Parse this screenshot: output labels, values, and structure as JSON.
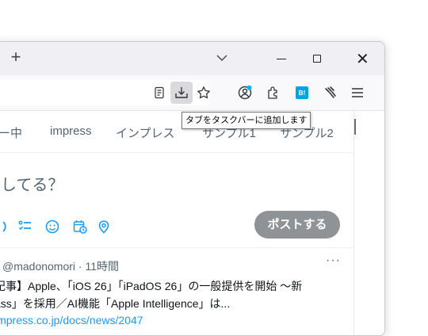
{
  "titlebar": {
    "new_tab_glyph": "+",
    "tab_list_icon": "chevron-down-icon",
    "window_controls": [
      "minimize",
      "maximize",
      "close"
    ],
    "close_glyph": "✕"
  },
  "toolbar": {
    "buttons": [
      "reader-view-icon",
      "download-to-taskbar-icon",
      "bookmark-star-icon",
      "account-icon",
      "extensions-icon",
      "hatena-bookmark-icon",
      "extension-icon",
      "menu-icon"
    ],
    "hatena_label": "B!",
    "tooltip": "タブをタスクバーに追加します"
  },
  "nav": {
    "items": [
      "ー中",
      "impress",
      "インプレス",
      "サンプル1",
      "サンプル2"
    ]
  },
  "compose": {
    "placeholder": "してる？",
    "post_button": "ポストする",
    "icons": [
      "gif-icon",
      "poll-icon",
      "emoji-icon",
      "schedule-icon",
      "location-icon"
    ]
  },
  "tweet": {
    "handle": "@madonomori",
    "separator": "·",
    "time": "11時間",
    "more": "···",
    "line1": "記事】Apple、「iOS 26」「iPadOS 26」の一般提供を開始 ～新",
    "line2": "ass」を採用／AI機能「Apple Intelligence」は...",
    "link": "impress.co.jp/docs/news/2047"
  },
  "colors": {
    "accent": "#1d9bf0",
    "post_button": "#8f9396",
    "muted_text": "#536471",
    "hatena": "#00a4de",
    "notify_dot": "#00b3f4"
  }
}
